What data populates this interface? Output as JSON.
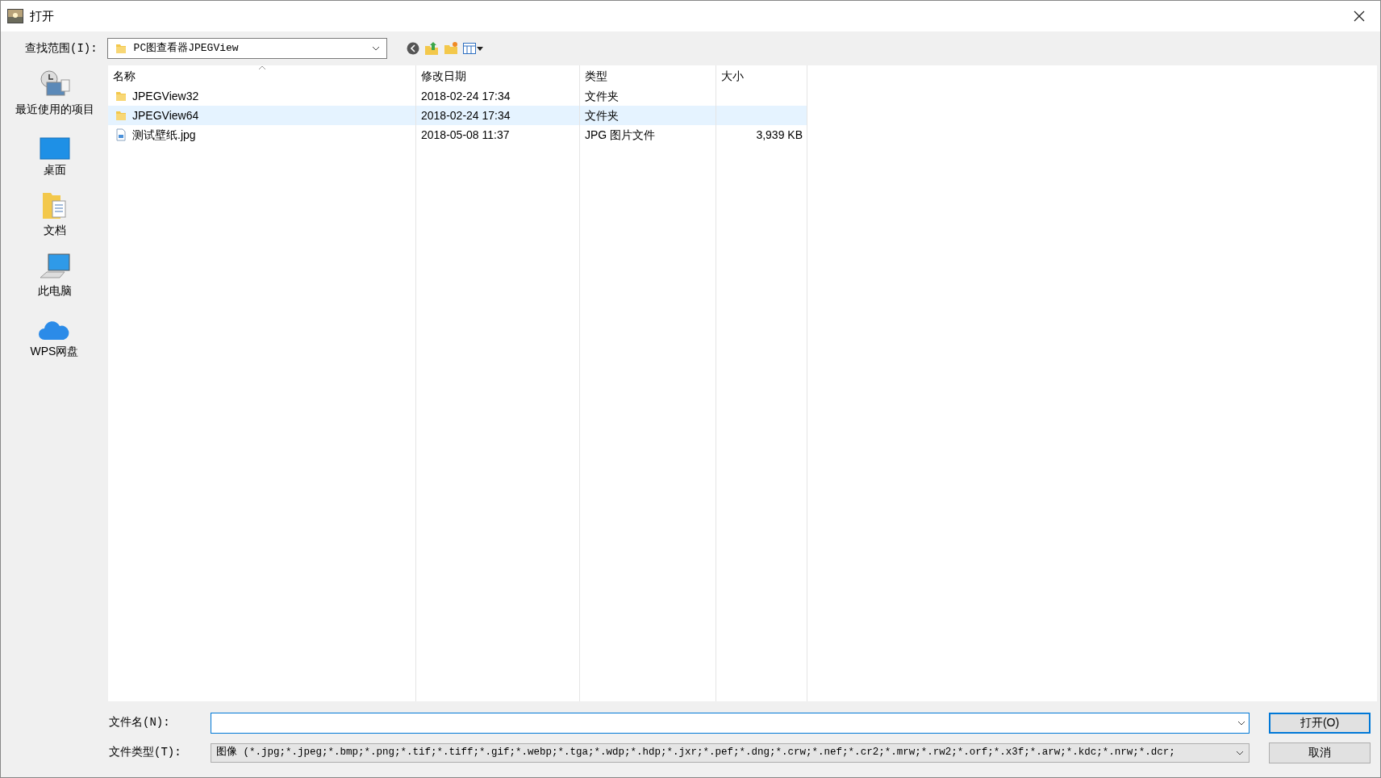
{
  "window": {
    "title": "打开"
  },
  "look_in": {
    "label": "查找范围(I):",
    "value": "PC图查看器JPEGView"
  },
  "sidebar": {
    "items": [
      {
        "label": "最近使用的项目",
        "kind": "recent"
      },
      {
        "label": "桌面",
        "kind": "desktop"
      },
      {
        "label": "文档",
        "kind": "documents"
      },
      {
        "label": "此电脑",
        "kind": "computer"
      },
      {
        "label": "WPS网盘",
        "kind": "cloud"
      }
    ]
  },
  "table": {
    "columns": [
      "名称",
      "修改日期",
      "类型",
      "大小"
    ],
    "rows": [
      {
        "name": "JPEGView32",
        "date": "2018-02-24 17:34",
        "type": "文件夹",
        "size": "",
        "kind": "folder",
        "selected": false
      },
      {
        "name": "JPEGView64",
        "date": "2018-02-24 17:34",
        "type": "文件夹",
        "size": "",
        "kind": "folder",
        "selected": true
      },
      {
        "name": "测试壁纸.jpg",
        "date": "2018-05-08 11:37",
        "type": "JPG 图片文件",
        "size": "3,939 KB",
        "kind": "image",
        "selected": false
      }
    ]
  },
  "file_name": {
    "label": "文件名(N):"
  },
  "file_type": {
    "label": "文件类型(T):",
    "value": "图像 (*.jpg;*.jpeg;*.bmp;*.png;*.tif;*.tiff;*.gif;*.webp;*.tga;*.wdp;*.hdp;*.jxr;*.pef;*.dng;*.crw;*.nef;*.cr2;*.mrw;*.rw2;*.orf;*.x3f;*.arw;*.kdc;*.nrw;*.dcr;"
  },
  "buttons": [
    "打开(O)",
    "取消"
  ]
}
